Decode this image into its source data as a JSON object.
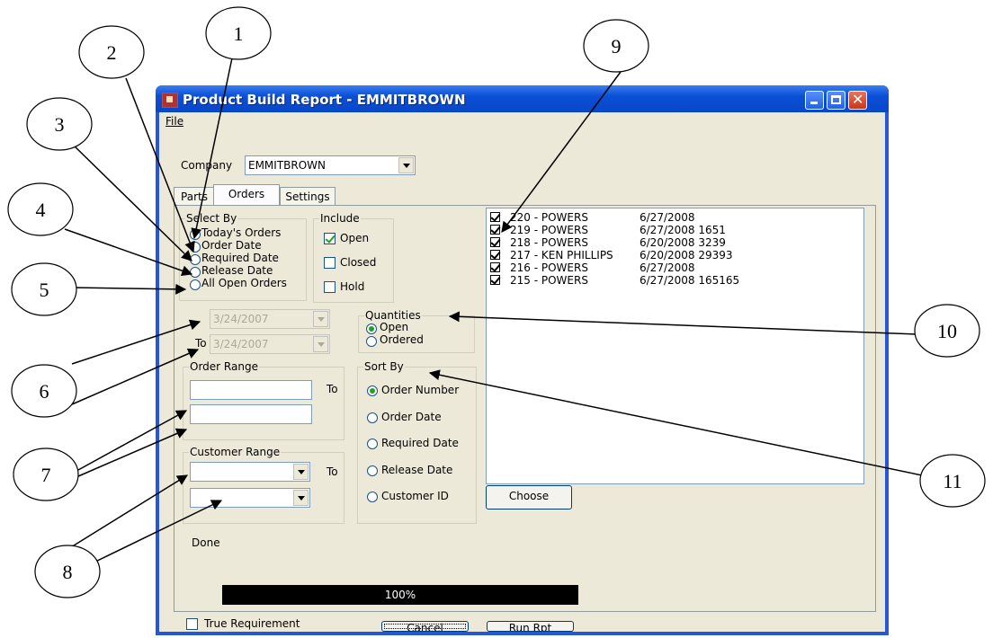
{
  "window": {
    "title": "Product Build Report - EMMITBROWN",
    "menu_file": "File"
  },
  "company": {
    "label": "Company",
    "value": "EMMITBROWN"
  },
  "tabs": [
    {
      "label": "Parts"
    },
    {
      "label": "Orders"
    },
    {
      "label": "Settings"
    }
  ],
  "select_by": {
    "legend": "Select By",
    "options": [
      "Today's Orders",
      "Order Date",
      "Required Date",
      "Release Date",
      "All Open Orders"
    ]
  },
  "include": {
    "legend": "Include",
    "options": [
      {
        "label": "Open",
        "checked": true
      },
      {
        "label": "Closed",
        "checked": false
      },
      {
        "label": "Hold",
        "checked": false
      }
    ]
  },
  "dates": {
    "from": "3/24/2007",
    "to_label": "To",
    "to": "3/24/2007"
  },
  "quantities": {
    "legend": "Quantities",
    "options": [
      "Open",
      "Ordered"
    ],
    "selected": "Open"
  },
  "order_range": {
    "legend": "Order Range",
    "to_label": "To"
  },
  "customer_range": {
    "legend": "Customer Range",
    "to_label": "To"
  },
  "sort_by": {
    "legend": "Sort By",
    "options": [
      "Order Number",
      "Order Date",
      "Required Date",
      "Release Date",
      "Customer ID"
    ],
    "selected": "Order Number"
  },
  "orders_list": [
    {
      "name": "220 - POWERS",
      "detail": "6/27/2008",
      "checked": true
    },
    {
      "name": "219 - POWERS",
      "detail": "6/27/2008 1651",
      "checked": true
    },
    {
      "name": "218 - POWERS",
      "detail": "6/20/2008 3239",
      "checked": true
    },
    {
      "name": "217 - KEN PHILLIPS",
      "detail": "6/20/2008 29393",
      "checked": true
    },
    {
      "name": "216 - POWERS",
      "detail": "6/27/2008",
      "checked": true
    },
    {
      "name": "215 - POWERS",
      "detail": "6/27/2008 165165",
      "checked": true
    }
  ],
  "buttons": {
    "choose": "Choose",
    "cancel": "Cancel",
    "run": "Run Rpt"
  },
  "status": {
    "text": "Done",
    "progress_text": "100%",
    "progress": 1.0
  },
  "true_requirement": {
    "label": "True Requirement",
    "checked": false
  },
  "annotations": [
    "1",
    "2",
    "3",
    "4",
    "5",
    "6",
    "7",
    "8",
    "9",
    "10",
    "11"
  ]
}
